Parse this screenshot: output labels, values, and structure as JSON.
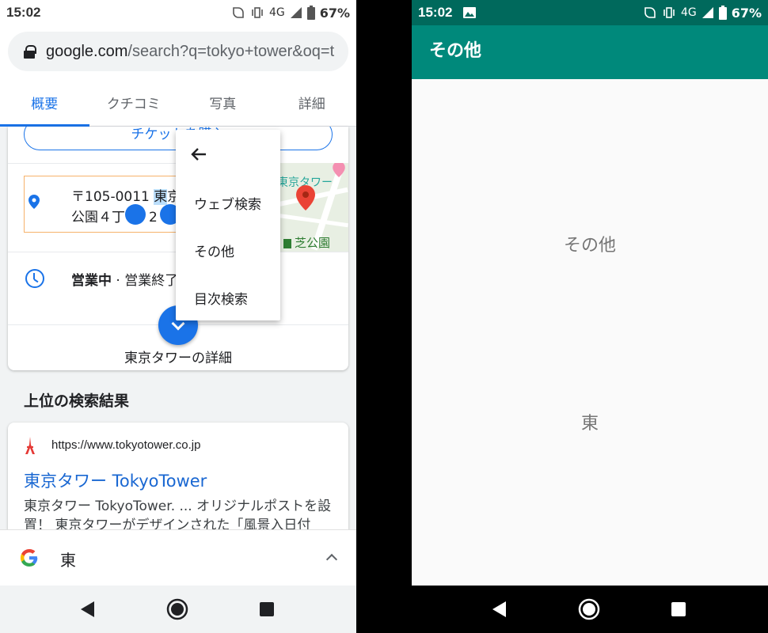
{
  "left": {
    "status": {
      "time": "15:02",
      "network": "4G",
      "battery": "67%"
    },
    "url": {
      "host": "google.com",
      "path": "/search?q=tokyo+tower&oq=t"
    },
    "tabs": [
      {
        "label": "概要"
      },
      {
        "label": "クチコミ"
      },
      {
        "label": "写真"
      },
      {
        "label": "詳細"
      }
    ],
    "card": {
      "ticket_button": "チケットを購入",
      "address_line1_a": "〒105-0011 ",
      "address_line1_b": "東",
      "address_line1_c": "京",
      "address_line2_a": "公園４丁",
      "address_line2_b": "2 –",
      "map_label_tower": "東京タワー",
      "map_label_park": "芝公園",
      "hours_bold": "営業中",
      "hours_rest": " · 営業終了",
      "details_link": "東京タワーの詳細"
    },
    "context_menu": {
      "back_icon": "arrow-left-icon",
      "items": [
        "ウェブ検索",
        "その他",
        "目次検索"
      ]
    },
    "section_heading": "上位の検索結果",
    "result": {
      "url": "https://www.tokyotower.co.jp",
      "title": "東京タワー TokyoTower",
      "snippet": "東京タワー TokyoTower. ... オリジナルポストを設置！ 東京タワーがデザインされた「風景入日付"
    },
    "bottom_bar": {
      "query": "東"
    }
  },
  "right": {
    "status": {
      "time": "15:02",
      "network": "4G",
      "battery": "67%"
    },
    "appbar_title": "その他",
    "content_label": "その他",
    "content_value": "東"
  },
  "colors": {
    "google_blue": "#1a73e8",
    "teal_appbar": "#00897b",
    "teal_status": "#00695c"
  }
}
